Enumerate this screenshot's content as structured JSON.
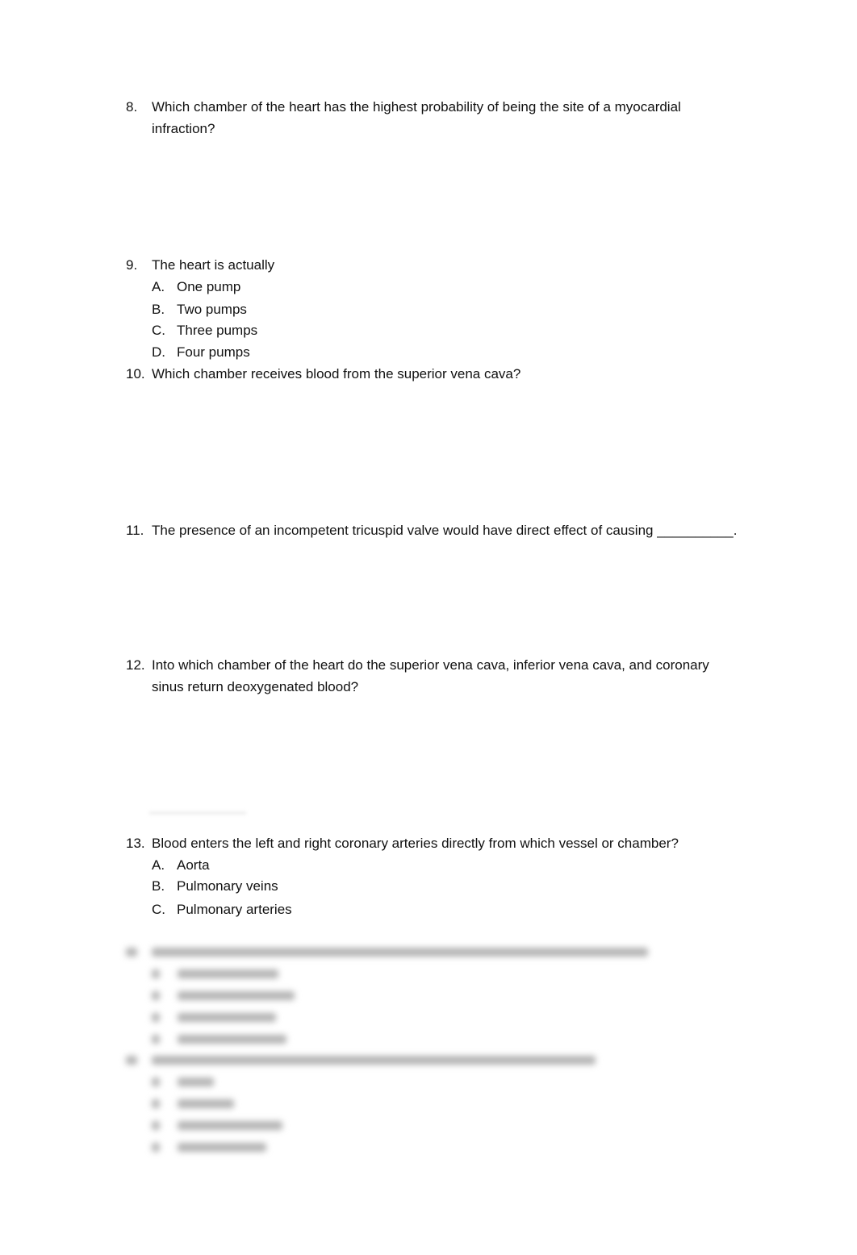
{
  "questions": [
    {
      "number": "8.",
      "text": "Which chamber of the heart has the highest probability of being the site of a myocardial infraction?"
    },
    {
      "number": "9.",
      "text": "The heart is actually",
      "options": [
        {
          "letter": "A.",
          "text": "One pump"
        },
        {
          "letter": "B.",
          "text": "Two pumps"
        },
        {
          "letter": "C.",
          "text": "Three pumps"
        },
        {
          "letter": "D.",
          "text": "Four pumps"
        }
      ]
    },
    {
      "number": "10.",
      "text": "Which chamber receives blood from the superior vena cava?"
    },
    {
      "number": "11.",
      "text": "The presence of an incompetent tricuspid valve would have direct effect of causing __________."
    },
    {
      "number": "12.",
      "text": "Into which chamber of the heart do the superior vena cava, inferior vena cava, and coronary sinus return deoxygenated blood?"
    },
    {
      "number": "13.",
      "text": "Blood enters the left and right coronary arteries directly from which vessel or chamber?",
      "options": [
        {
          "letter": "A.",
          "text": "Aorta"
        },
        {
          "letter": "B.",
          "text": "Pulmonary veins"
        },
        {
          "letter": "C.",
          "text": "Pulmonary arteries"
        }
      ]
    }
  ],
  "blurred_section": {
    "note": "Questions 14 and 15 with options are blurred and illegible"
  }
}
